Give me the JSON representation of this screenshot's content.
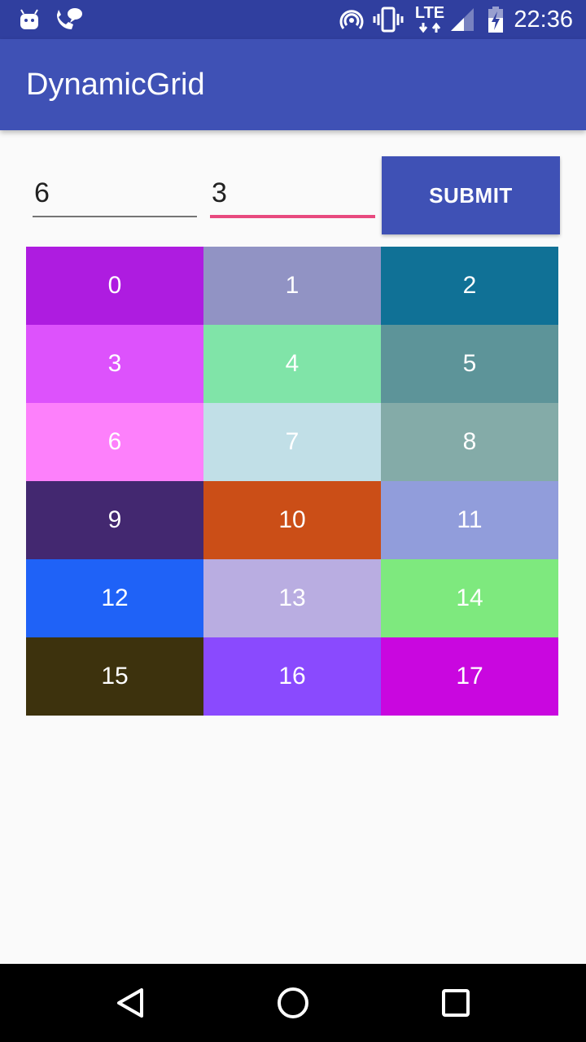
{
  "status_bar": {
    "time": "22:36",
    "network_label": "LTE",
    "icons": [
      "android-debug-icon",
      "voicemail-icon",
      "hotspot-icon",
      "vibrate-icon",
      "lte-signal-icon",
      "signal-strength-icon",
      "battery-charging-icon"
    ]
  },
  "app_bar": {
    "title": "DynamicGrid"
  },
  "form": {
    "rows_value": "6",
    "cols_value": "3",
    "submit_label": "SUBMIT"
  },
  "grid": {
    "columns": 3,
    "cells": [
      {
        "label": "0",
        "color": "#ae1ce0"
      },
      {
        "label": "1",
        "color": "#9193c4"
      },
      {
        "label": "2",
        "color": "#107196"
      },
      {
        "label": "3",
        "color": "#dd52fc"
      },
      {
        "label": "4",
        "color": "#80e4a8"
      },
      {
        "label": "5",
        "color": "#5d9499"
      },
      {
        "label": "6",
        "color": "#fd80fb"
      },
      {
        "label": "7",
        "color": "#c1dfe7"
      },
      {
        "label": "8",
        "color": "#84aba8"
      },
      {
        "label": "9",
        "color": "#432870"
      },
      {
        "label": "10",
        "color": "#cb4e17"
      },
      {
        "label": "11",
        "color": "#919ddb"
      },
      {
        "label": "12",
        "color": "#1f62f7"
      },
      {
        "label": "13",
        "color": "#b9ade1"
      },
      {
        "label": "14",
        "color": "#7ee97e"
      },
      {
        "label": "15",
        "color": "#3d320d"
      },
      {
        "label": "16",
        "color": "#8a4afe"
      },
      {
        "label": "17",
        "color": "#c907df"
      }
    ]
  },
  "nav_bar": {
    "icons": [
      "back-icon",
      "home-icon",
      "recents-icon"
    ]
  },
  "colors": {
    "primary": "#3f51b5",
    "primary_dark": "#303f9f",
    "accent": "#e84a7f",
    "background": "#fafafa"
  }
}
